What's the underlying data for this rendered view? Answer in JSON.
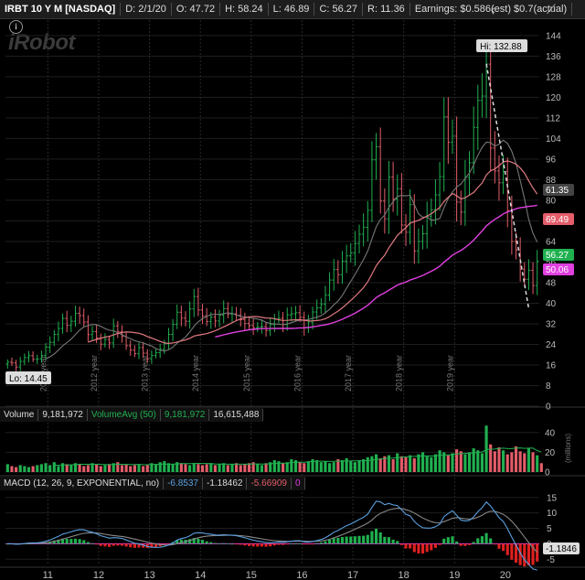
{
  "header": {
    "symbol": "IRBT 10 Y M [NASDAQ]",
    "date": "D: 2/1/20",
    "open": "O: 47.72",
    "high": "H: 58.24",
    "low": "L: 46.89",
    "close": "C: 56.27",
    "range": "R: 11.36",
    "earnings": "Earnings: $0.586(est) $0.7(actual)"
  },
  "logo_text": "iRobot",
  "price_panel": {
    "y_ticks": [
      "144",
      "136",
      "128",
      "120",
      "112",
      "104",
      "96",
      "88",
      "80",
      "72",
      "64",
      "56",
      "48",
      "40",
      "32",
      "24",
      "16",
      "8",
      "0"
    ],
    "year_labels": [
      "2011 year",
      "2012 year",
      "2013 year",
      "2014 year",
      "2015 year",
      "2016 year",
      "2017 year",
      "2018 year",
      "2019 year"
    ],
    "hi_note": "Hi: 132.88",
    "lo_note": "Lo: 14.45",
    "tags": [
      {
        "text": "61.35",
        "bg": "#444444",
        "fg": "#ffffff"
      },
      {
        "text": "69.49",
        "bg": "#e35d6a",
        "fg": "#ffffff"
      },
      {
        "text": "56.27",
        "bg": "#20b050",
        "fg": "#ffffff"
      },
      {
        "text": "50.06",
        "bg": "#e040e0",
        "fg": "#ffffff"
      }
    ]
  },
  "volume_panel": {
    "label": "Volume",
    "value": "9,181,972",
    "avg_label": "VolumeAvg (50)",
    "avg_value": "9,181,972",
    "avg2": "16,615,488",
    "y_ticks": [
      "40",
      "20",
      "0"
    ],
    "unit": "(millions)"
  },
  "macd_panel": {
    "label": "MACD (12, 26, 9, EXPONENTIAL, no)",
    "v1": "-6.8537",
    "v2": "-1.18462",
    "v3": "-5.66909",
    "v4": "0",
    "y_ticks": [
      "15",
      "10",
      "5",
      "0",
      "-5"
    ],
    "tag": "-1.1846"
  },
  "x_axis": [
    "11",
    "12",
    "13",
    "14",
    "15",
    "16",
    "17",
    "18",
    "19",
    "20"
  ],
  "colors": {
    "up": "#20b050",
    "down": "#e35d6a",
    "sma_gray": "#777777",
    "sma_red": "#e07a80",
    "sma_magenta": "#e040e0",
    "macd_line": "#5aa0e0",
    "signal_line": "#888888"
  },
  "chart_data": {
    "type": "candlestick",
    "ylim": [
      0,
      150
    ],
    "x_range": [
      "2010-03",
      "2020-02"
    ],
    "price_monthly_close": [
      17.1,
      16.8,
      15.2,
      17.4,
      18.9,
      19.6,
      18.2,
      18.4,
      19.7,
      22.9,
      24.8,
      27.9,
      30.2,
      34.1,
      31.4,
      33.0,
      36.1,
      35.2,
      32.7,
      27.8,
      29.0,
      26.5,
      24.1,
      25.9,
      24.6,
      31.2,
      28.9,
      27.1,
      23.5,
      21.8,
      20.4,
      22.8,
      20.6,
      18.4,
      19.7,
      20.8,
      22.1,
      24.3,
      27.9,
      31.8,
      36.5,
      34.2,
      33.0,
      37.8,
      42.6,
      37.4,
      35.1,
      32.9,
      34.6,
      33.1,
      35.4,
      37.9,
      35.8,
      35.9,
      35.4,
      33.6,
      32.1,
      31.3,
      30.5,
      30.8,
      31.0,
      29.4,
      31.7,
      33.8,
      34.2,
      31.7,
      35.5,
      35.9,
      36.3,
      34.5,
      30.4,
      32.7,
      36.6,
      38.2,
      39.7,
      43.2,
      49.0,
      53.1,
      51.1,
      56.3,
      58.4,
      59.5,
      63.2,
      66.8,
      69.5,
      76.1,
      95.7,
      100.8,
      79.7,
      72.8,
      89.0,
      80.5,
      84.5,
      70.4,
      67.6,
      78.3,
      60.3,
      64.0,
      67.0,
      73.8,
      76.3,
      82.1,
      89.2,
      112.4,
      102.6,
      104.9,
      79.3,
      75.4,
      88.9,
      94.6,
      108.3,
      118.8,
      120.5,
      132.9,
      100.3,
      91.4,
      86.8,
      91.2,
      76.0,
      64.0,
      60.8,
      53.2,
      49.3,
      52.8,
      46.9,
      56.3
    ],
    "volume_monthly_millions": [
      8,
      6,
      5,
      7,
      6,
      5,
      6,
      7,
      8,
      9,
      7,
      10,
      6,
      9,
      8,
      7,
      9,
      8,
      6,
      7,
      9,
      8,
      6,
      7,
      8,
      9,
      10,
      7,
      8,
      6,
      7,
      8,
      6,
      7,
      9,
      8,
      10,
      11,
      9,
      8,
      10,
      9,
      8,
      7,
      9,
      8,
      7,
      8,
      9,
      7,
      8,
      9,
      7,
      8,
      9,
      7,
      8,
      9,
      10,
      8,
      7,
      9,
      10,
      12,
      11,
      9,
      10,
      13,
      12,
      10,
      9,
      11,
      13,
      12,
      10,
      11,
      9,
      10,
      13,
      12,
      14,
      11,
      10,
      12,
      13,
      15,
      16,
      18,
      14,
      16,
      17,
      13,
      19,
      16,
      15,
      17,
      14,
      18,
      20,
      16,
      15,
      18,
      22,
      20,
      17,
      19,
      23,
      21,
      18,
      20,
      24,
      22,
      19,
      47,
      28,
      21,
      25,
      22,
      18,
      20,
      26,
      21,
      19,
      24,
      20,
      17,
      9
    ],
    "macd": {
      "fast": 12,
      "slow": 26,
      "signal": 9
    }
  }
}
